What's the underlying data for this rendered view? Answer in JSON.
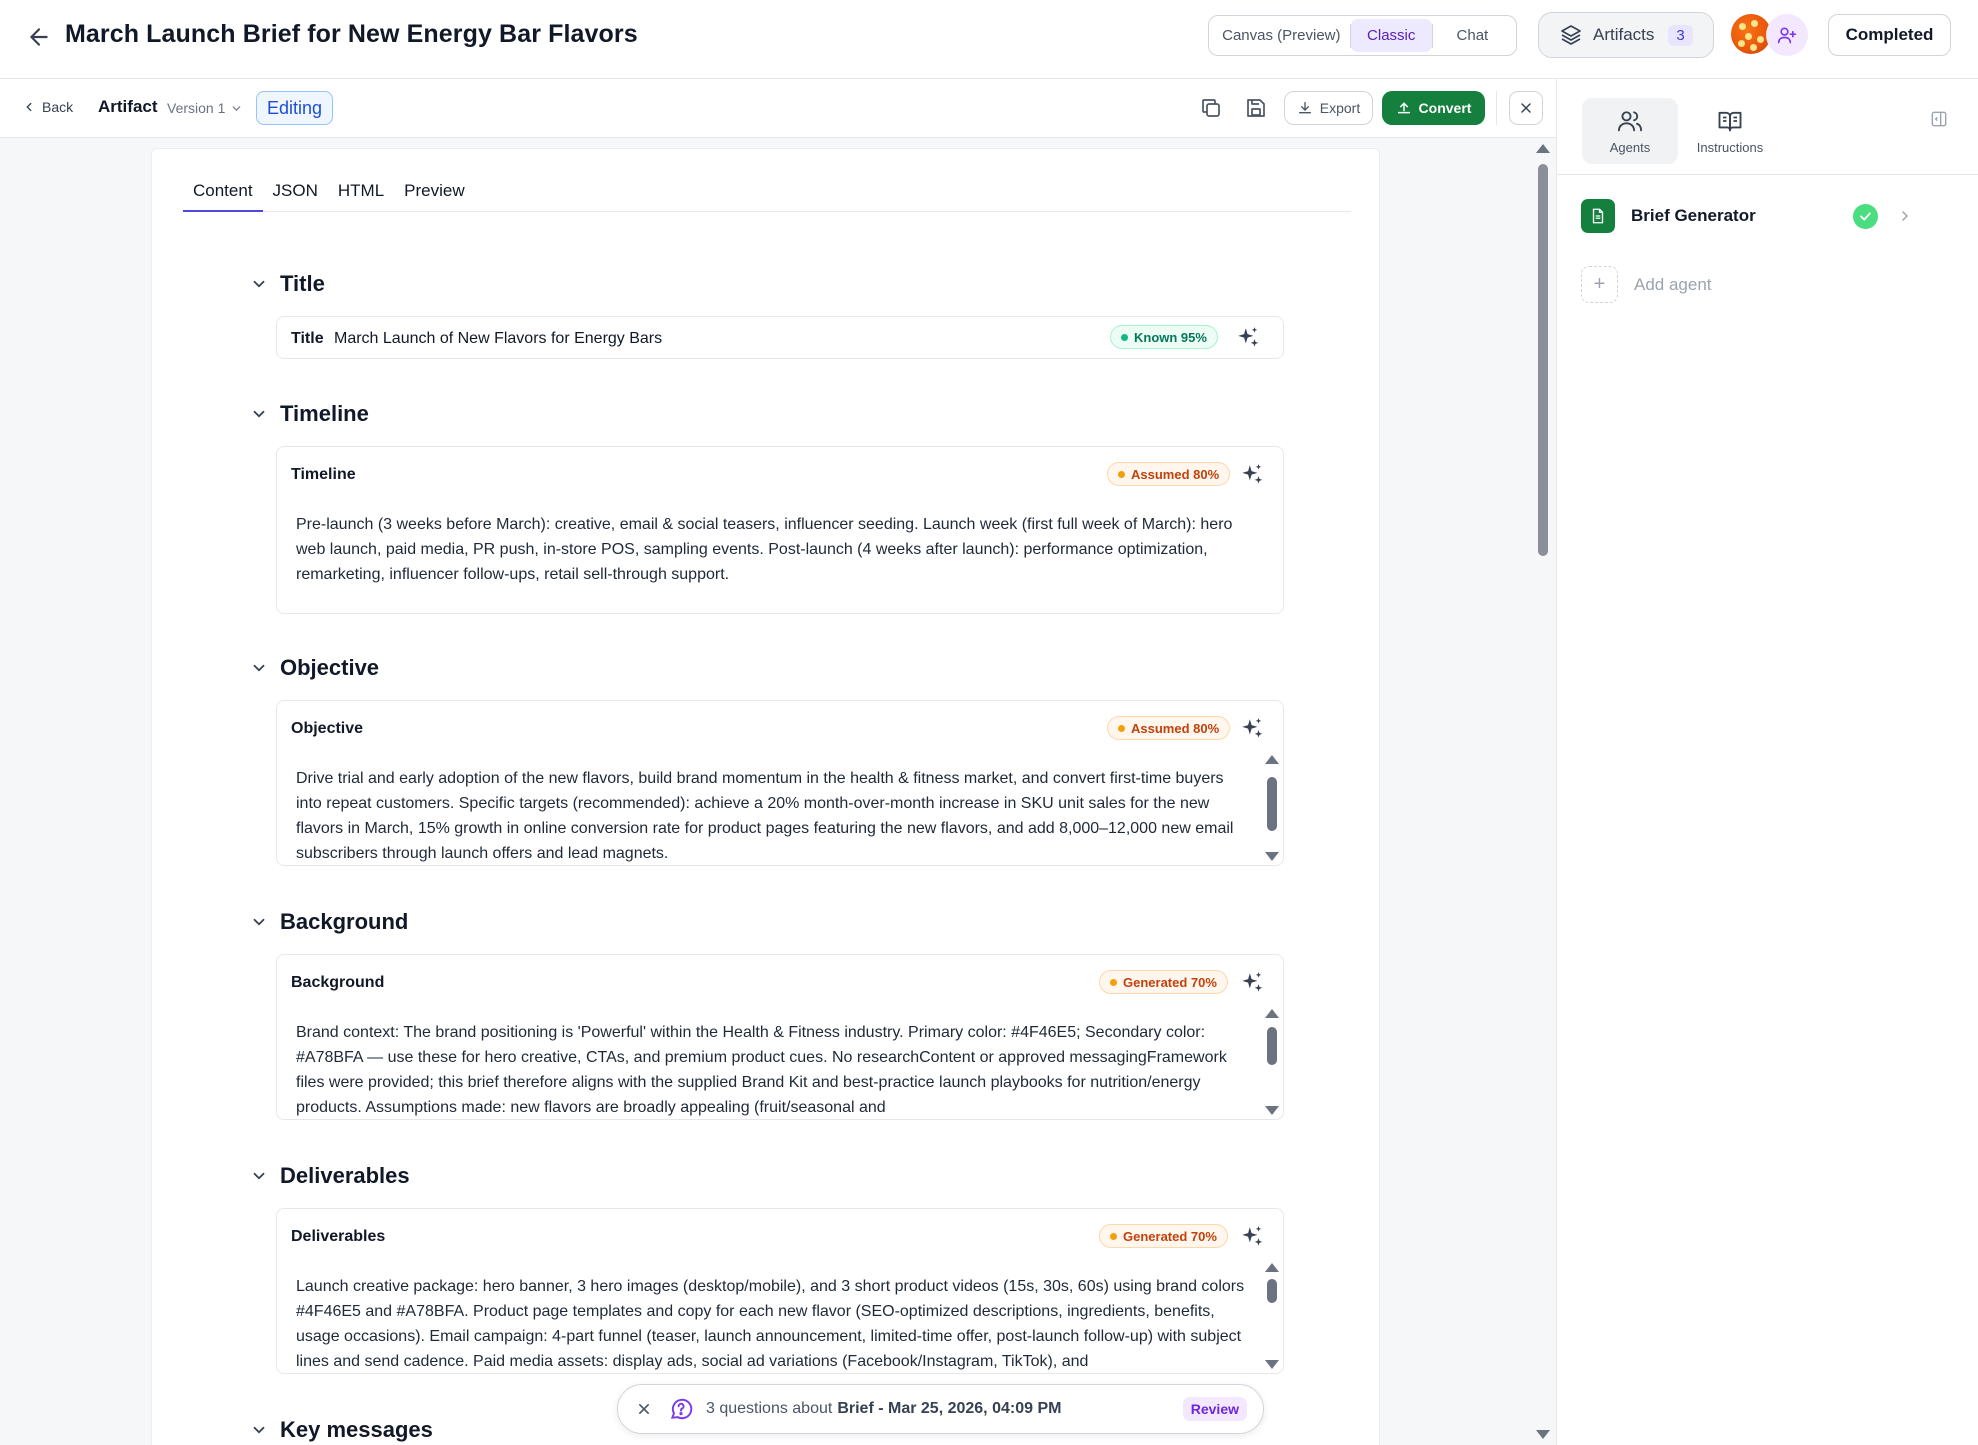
{
  "header": {
    "title": "March Launch Brief for New Energy Bar Flavors",
    "view_options": [
      "Canvas (Preview)",
      "Classic",
      "Chat"
    ],
    "active_view": "Classic",
    "artifacts_label": "Artifacts",
    "artifacts_count": "3",
    "status_label": "Completed"
  },
  "toolbar": {
    "back_label": "Back",
    "artifact_label": "Artifact",
    "version_label": "Version 1",
    "editing_label": "Editing",
    "export_label": "Export",
    "convert_label": "Convert"
  },
  "tabs": [
    "Content",
    "JSON",
    "HTML",
    "Preview"
  ],
  "active_tab": "Content",
  "sections": {
    "title": {
      "heading": "Title",
      "label": "Title",
      "value": "March Launch of New Flavors for Energy Bars",
      "badge": "Known 95%"
    },
    "timeline": {
      "heading": "Timeline",
      "label": "Timeline",
      "badge": "Assumed 80%",
      "text": "Pre-launch (3 weeks before March): creative, email & social teasers, influencer seeding. Launch week (first full week of March): hero web launch, paid media, PR push, in-store POS, sampling events. Post-launch (4 weeks after launch): performance optimization, remarketing, influencer follow-ups, retail sell-through support."
    },
    "objective": {
      "heading": "Objective",
      "label": "Objective",
      "badge": "Assumed 80%",
      "text": "Drive trial and early adoption of the new flavors, build brand momentum in the health & fitness market, and convert first-time buyers into repeat customers. Specific targets (recommended): achieve a 20% month-over-month increase in SKU unit sales for the new flavors in March, 15% growth in online conversion rate for product pages featuring the new flavors, and add 8,000–12,000 new email subscribers through launch offers and lead magnets."
    },
    "background": {
      "heading": "Background",
      "label": "Background",
      "badge": "Generated 70%",
      "text": "Brand context: The brand positioning is 'Powerful' within the Health & Fitness industry. Primary color: #4F46E5; Secondary color: #A78BFA — use these for hero creative, CTAs, and premium product cues. No researchContent or approved messagingFramework files were provided; this brief therefore aligns with the supplied Brand Kit and best-practice launch playbooks for nutrition/energy products. Assumptions made: new flavors are broadly appealing (fruit/seasonal and"
    },
    "deliverables": {
      "heading": "Deliverables",
      "label": "Deliverables",
      "badge": "Generated 70%",
      "text": "Launch creative package: hero banner, 3 hero images (desktop/mobile), and 3 short product videos (15s, 30s, 60s) using brand colors #4F46E5 and #A78BFA. Product page templates and copy for each new flavor (SEO-optimized descriptions, ingredients, benefits, usage occasions). Email campaign: 4-part funnel (teaser, launch announcement, limited-time offer, post-launch follow-up) with subject lines and send cadence. Paid media assets: display ads, social ad variations (Facebook/Instagram, TikTok), and"
    },
    "key_messages": {
      "heading": "Key messages"
    }
  },
  "question_bar": {
    "text": "3 questions about",
    "subject": "Brief - Mar 25, 2026, 04:09 PM",
    "review_label": "Review"
  },
  "right_panel": {
    "tabs": [
      "Agents",
      "Instructions"
    ],
    "active_tab": "Agents",
    "agents": [
      {
        "name": "Brief Generator",
        "status": "complete"
      }
    ],
    "add_agent_label": "Add agent"
  },
  "colors": {
    "accent": "#4F46E5",
    "convert_green": "#15803D",
    "known": "#10B981",
    "assumed": "#F59E0B"
  }
}
